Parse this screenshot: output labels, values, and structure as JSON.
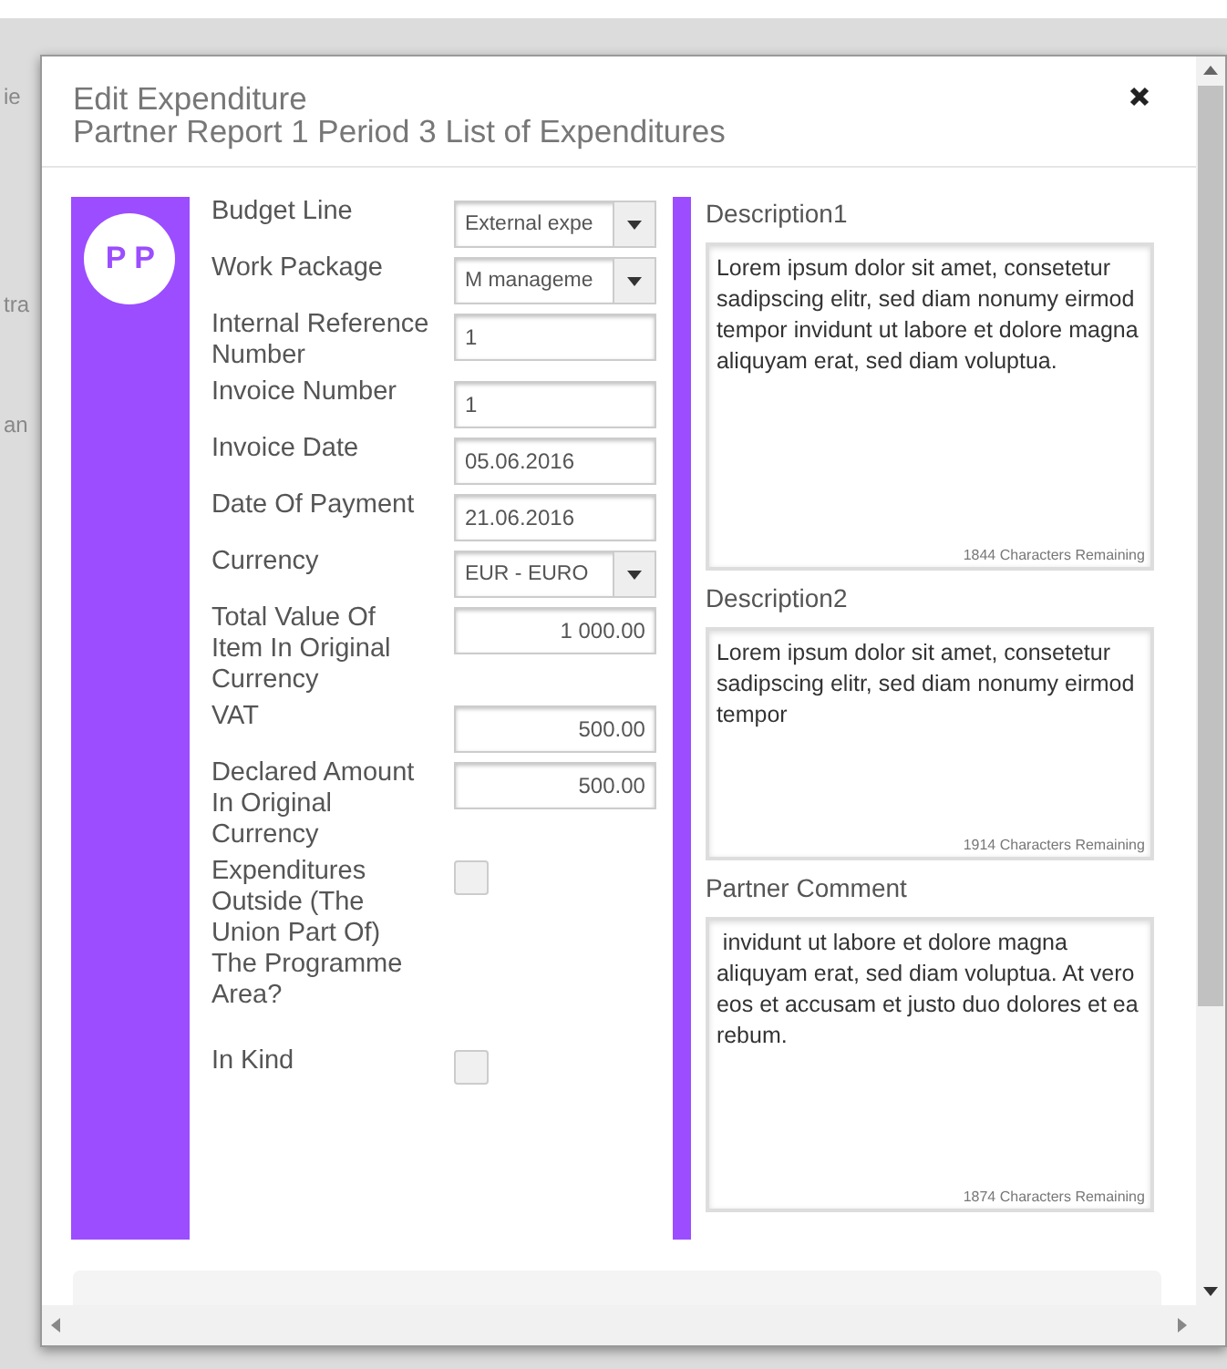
{
  "background_fragments": [
    "ie",
    "tra",
    "an"
  ],
  "dialog": {
    "title": "Edit Expenditure",
    "subtitle": "Partner Report 1 Period 3 List of Expenditures"
  },
  "avatar": {
    "initials": "P P"
  },
  "fields": [
    {
      "label": "Budget Line",
      "kind": "select",
      "value": "External expe"
    },
    {
      "label": "Work Package",
      "kind": "select",
      "value": "M manageme"
    },
    {
      "label": "Internal Reference Number",
      "kind": "text",
      "value": "1"
    },
    {
      "label": "Invoice Number",
      "kind": "text",
      "value": "1"
    },
    {
      "label": "Invoice Date",
      "kind": "date",
      "value": "05.06.2016"
    },
    {
      "label": "Date Of Payment",
      "kind": "date",
      "value": "21.06.2016"
    },
    {
      "label": "Currency",
      "kind": "select",
      "value": "EUR - EURO"
    },
    {
      "label": "Total Value Of Item In Original Currency",
      "kind": "amount",
      "value": "1 000.00"
    },
    {
      "label": "VAT",
      "kind": "amount",
      "value": "500.00"
    },
    {
      "label": "Declared Amount In Original Currency",
      "kind": "amount",
      "value": "500.00"
    },
    {
      "label": "Expenditures Outside (The Union Part Of) The Programme Area?",
      "kind": "checkbox",
      "checked": false
    },
    {
      "label": "In Kind",
      "kind": "checkbox",
      "checked": false
    }
  ],
  "text_areas": [
    {
      "label": "Description1",
      "value": "Lorem ipsum dolor sit amet, consetetur sadipscing elitr, sed diam nonumy eirmod tempor invidunt ut labore et dolore magna aliquyam erat, sed diam voluptua.",
      "remaining": "1844 Characters Remaining"
    },
    {
      "label": "Description2",
      "value": "Lorem ipsum dolor sit amet, consetetur sadipscing elitr, sed diam nonumy eirmod tempor",
      "remaining": "1914 Characters Remaining"
    },
    {
      "label": "Partner Comment",
      "value": " invidunt ut labore et dolore magna aliquyam erat, sed diam voluptua. At vero eos et accusam et justo duo dolores et ea rebum.",
      "remaining": "1874 Characters Remaining"
    }
  ]
}
